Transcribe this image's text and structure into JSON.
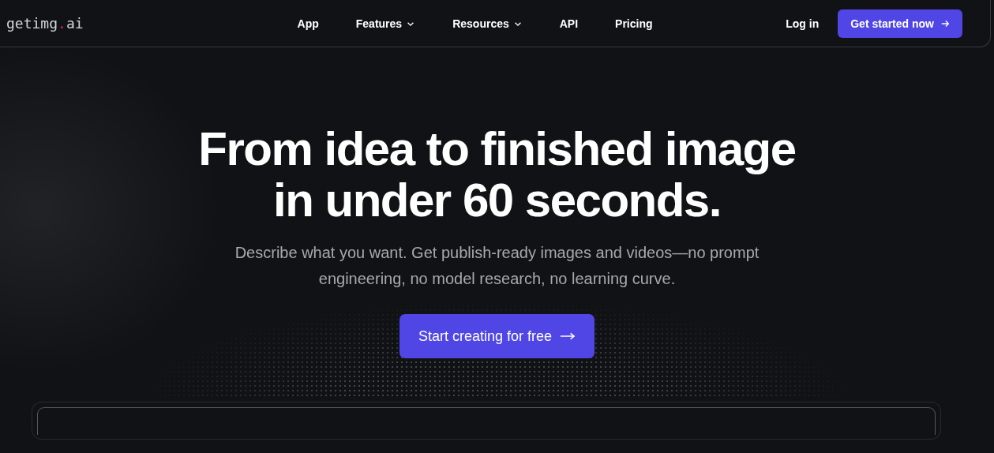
{
  "header": {
    "logo": {
      "name": "getimg",
      "dot": ".",
      "suffix": "ai"
    },
    "nav": [
      {
        "label": "App",
        "has_menu": false
      },
      {
        "label": "Features",
        "has_menu": true
      },
      {
        "label": "Resources",
        "has_menu": true
      },
      {
        "label": "API",
        "has_menu": false
      },
      {
        "label": "Pricing",
        "has_menu": false
      }
    ],
    "login": "Log in",
    "cta": "Get started now"
  },
  "hero": {
    "title_lines": [
      "From idea to finished image",
      "in under 60 seconds."
    ],
    "subtitle": "Describe what you want. Get publish-ready images and videos—no prompt engineering, no model research, no learning curve.",
    "button": "Start creating for free"
  },
  "preview": {
    "kind": "frame"
  }
}
